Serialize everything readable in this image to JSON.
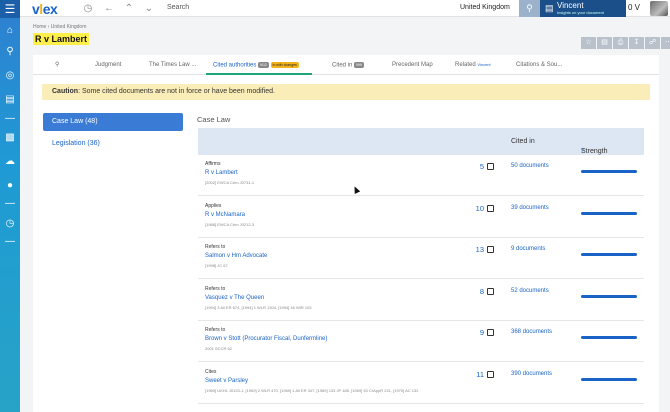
{
  "app": {
    "logo_main": "vlex",
    "logo_accent": "l"
  },
  "topbar": {
    "search_placeholder": "Search",
    "country": "United Kingdom",
    "user_name": "Vincent",
    "user_sub": "Insights on your document",
    "user_value": "0 V"
  },
  "breadcrumb": "Home  ›  United Kingdom",
  "page_title": "R v Lambert",
  "tabs": [
    {
      "label": "Judgment"
    },
    {
      "label": "The Times Law ..."
    },
    {
      "label": "Cited authorities",
      "badge": "9/12",
      "badge2": "In with changes"
    },
    {
      "label": "Cited in",
      "badge": "999"
    },
    {
      "label": "Precedent Map"
    },
    {
      "label": "Related",
      "sup": "Vincent"
    },
    {
      "label": "Citations & Sou..."
    }
  ],
  "caution": {
    "label": "Caution",
    "text": ": Some cited documents are not in force or have been modified."
  },
  "sidebar": [
    {
      "label": "Case Law (48)"
    },
    {
      "label": "Legislation (36)"
    }
  ],
  "section_title": "Case Law",
  "table_headers": {
    "cited_in": "Cited in",
    "strength": "Strength",
    "strength_help": "?"
  },
  "rows": [
    {
      "relation": "Affirms",
      "case": "R v Lambert",
      "citation": "[2002] EWCA Crim J0731-1",
      "count": "5",
      "cited_in": "50 documents"
    },
    {
      "relation": "Applies",
      "case": "R v McNamara",
      "citation": "[1988] EWCA Crim J0212-3",
      "count": "10",
      "cited_in": "39 documents"
    },
    {
      "relation": "Refers to",
      "case": "Salmon v Hm Advocate",
      "citation": "[1998] JC 67",
      "count": "13",
      "cited_in": "9 documents"
    },
    {
      "relation": "Refers to",
      "case": "Vasquez v The Queen",
      "citation": "[1994] 3 All ER 674, [1994] 1 WLR 1304, [1994] 45 WIR 103",
      "count": "8",
      "cited_in": "52 documents"
    },
    {
      "relation": "Refers to",
      "case": "Brown v Stott (Procurator Fiscal, Dunfermline)",
      "citation": "2001 SCCR 62",
      "count": "9",
      "cited_in": "368 documents"
    },
    {
      "relation": "Cites",
      "case": "Sweet v Parsley",
      "citation": "[1969] UKHL J0123-1, [1969] 2 WLR 470, [1969] 1 All ER 347, [1969] 133 JP 188, [1969] 53 CrAppR 221, [1970] AC 132",
      "count": "11",
      "cited_in": "390 documents"
    }
  ],
  "colors": {
    "brand": "#1a63c6",
    "highlight": "#ffef4a",
    "caution_bg": "#fbedb7",
    "active_tab_line": "#1fa37a"
  }
}
